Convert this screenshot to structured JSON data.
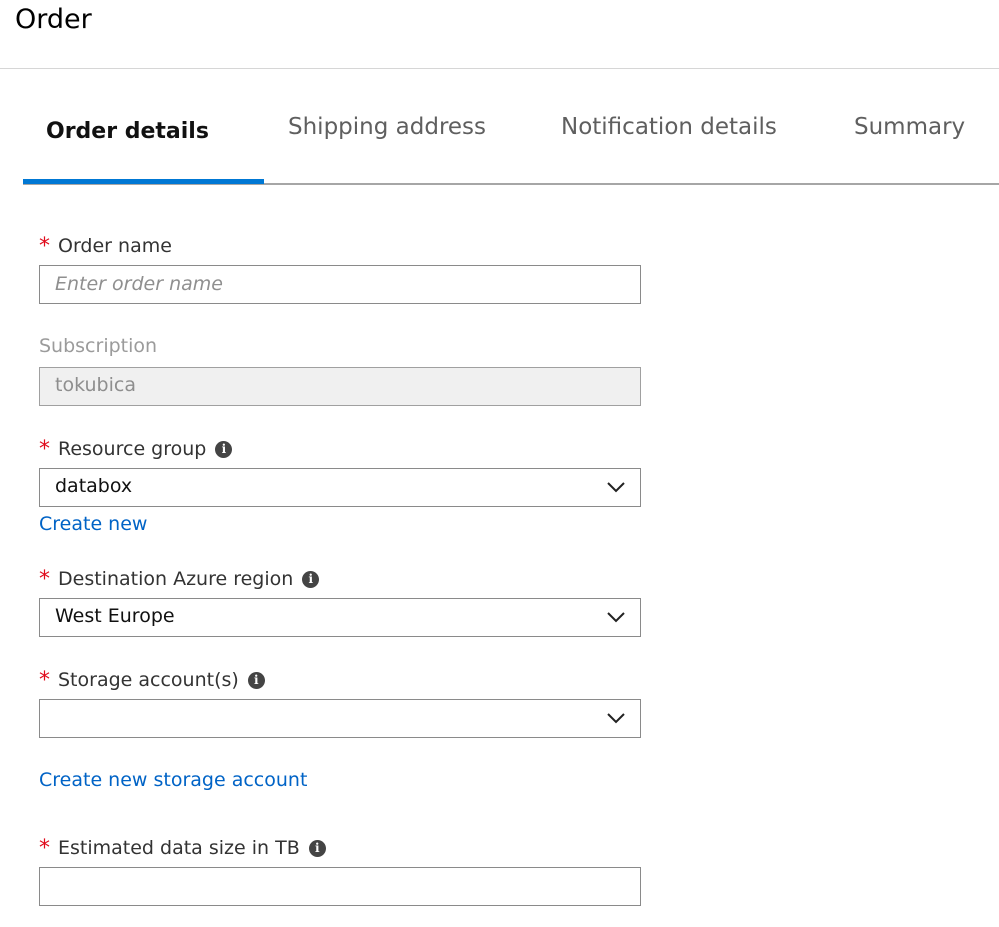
{
  "page": {
    "title": "Order"
  },
  "tabs": [
    {
      "label": "Order details",
      "active": true
    },
    {
      "label": "Shipping address",
      "active": false
    },
    {
      "label": "Notification details",
      "active": false
    },
    {
      "label": "Summary",
      "active": false
    }
  ],
  "form": {
    "order_name": {
      "label": "Order name",
      "required": "*",
      "value": "",
      "placeholder": "Enter order name"
    },
    "subscription": {
      "label": "Subscription",
      "value": "tokubica"
    },
    "resource_group": {
      "label": "Resource group",
      "required": "*",
      "value": "databox",
      "create_link": "Create new"
    },
    "destination_region": {
      "label": "Destination Azure region",
      "required": "*",
      "value": "West Europe"
    },
    "storage_accounts": {
      "label": "Storage account(s)",
      "required": "*",
      "value": "",
      "create_link": "Create new storage account"
    },
    "data_size": {
      "label": "Estimated data size in TB",
      "required": "*",
      "value": ""
    }
  },
  "icons": {
    "info": "info-icon",
    "dropdown": "chevron-down-icon",
    "info_glyph": "i"
  },
  "colors": {
    "accent": "#0078d4",
    "link": "#0063c6",
    "required": "#e00b1c"
  }
}
